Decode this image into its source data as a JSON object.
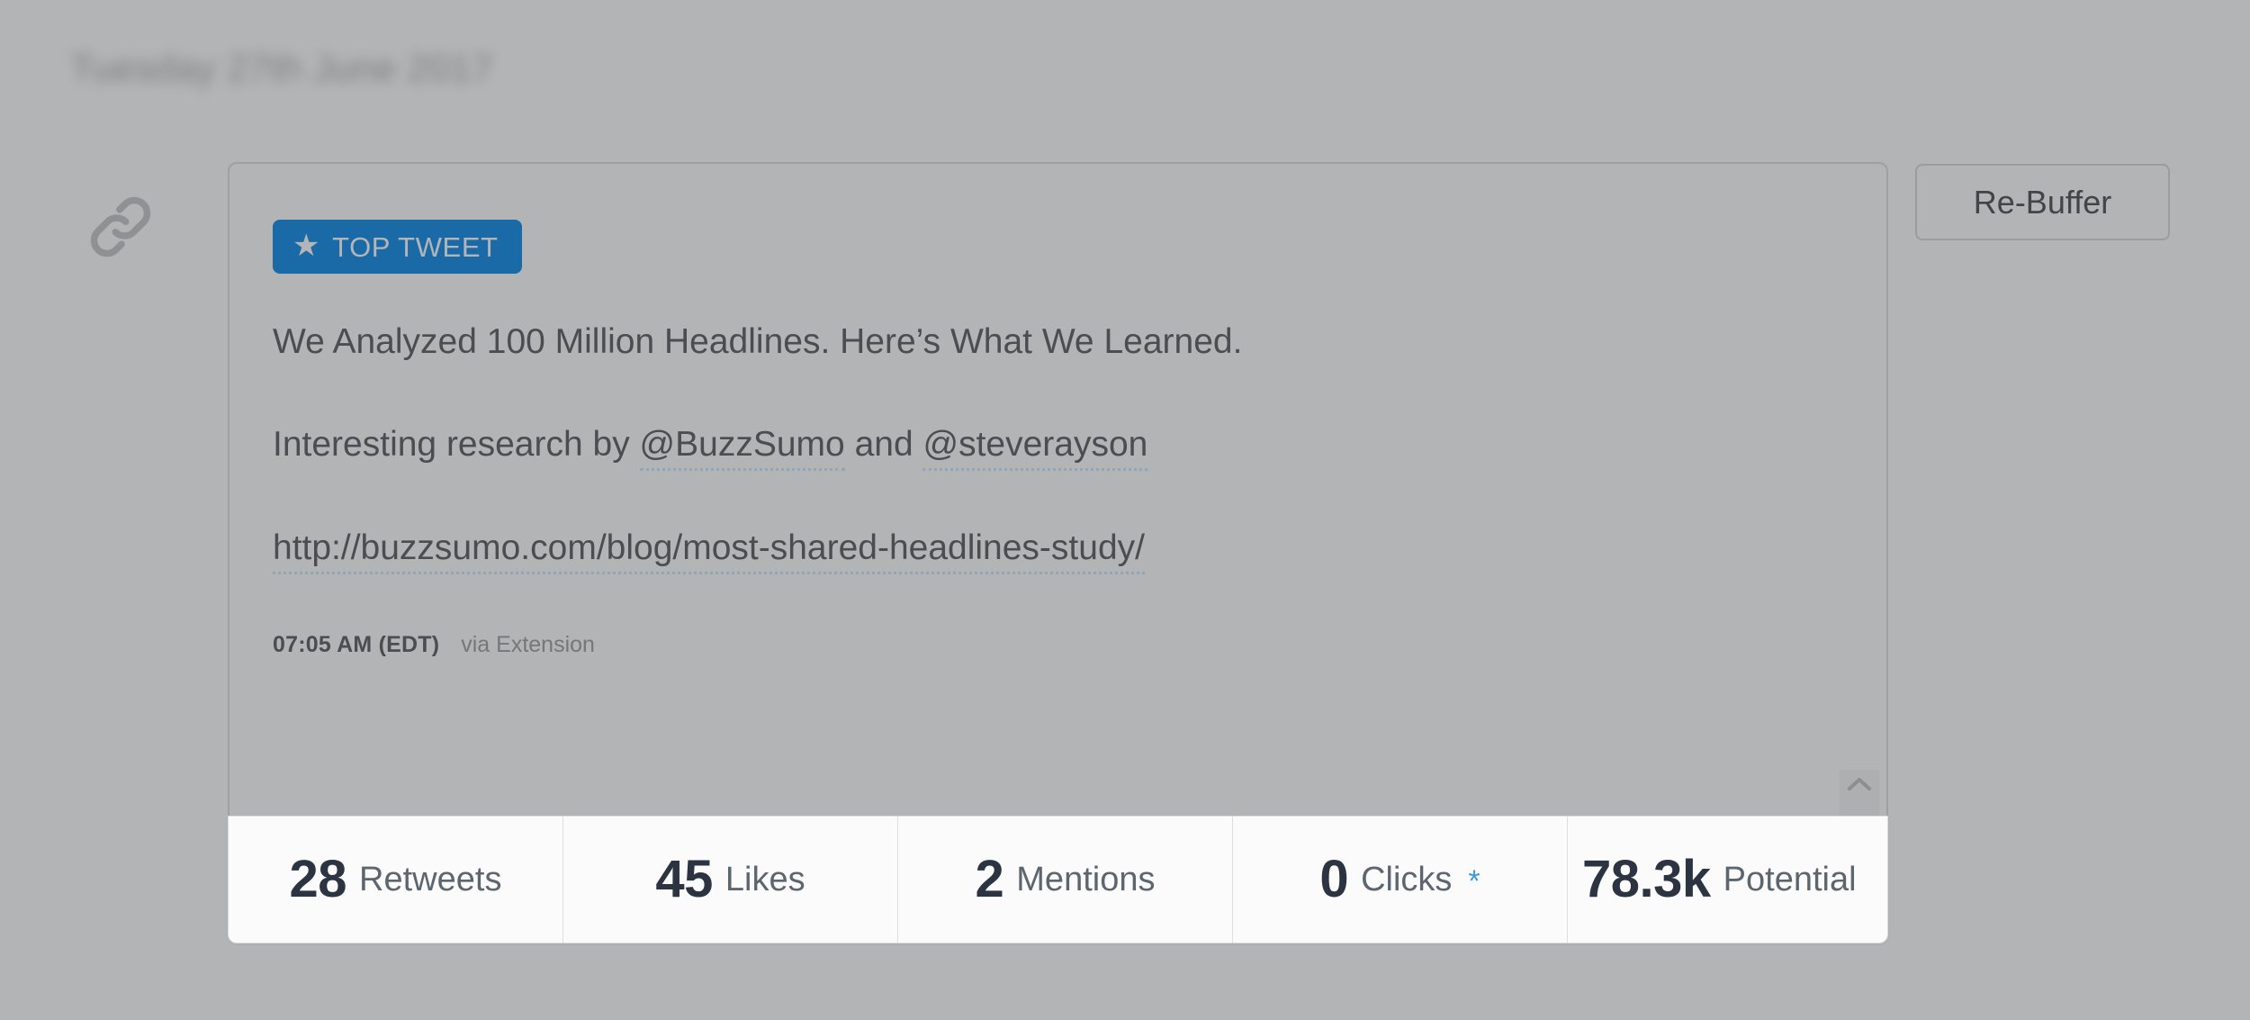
{
  "header": {
    "date_label": "Tuesday 27th June 2017"
  },
  "post": {
    "link_icon": "link-chain-icon",
    "badge": {
      "star_glyph": "★",
      "label": "TOP TWEET"
    },
    "text_lines": {
      "line1": "We Analyzed 100 Million Headlines. Here’s What We Learned.",
      "line2_prefix": "Interesting research by ",
      "mention1": "@BuzzSumo",
      "line2_middle": " and ",
      "mention2": "@steverayson",
      "line3_url": "http://buzzsumo.com/blog/most-shared-headlines-study/"
    },
    "meta": {
      "time": "07:05 AM (EDT)",
      "via": "via Extension"
    },
    "scroll_spinner": {
      "up_icon": "chevron-up-icon",
      "down_icon": "chevron-down-icon"
    },
    "stats": [
      {
        "value": "28",
        "label": "Retweets",
        "asterisk": ""
      },
      {
        "value": "45",
        "label": "Likes",
        "asterisk": ""
      },
      {
        "value": "2",
        "label": "Mentions",
        "asterisk": ""
      },
      {
        "value": "0",
        "label": "Clicks",
        "asterisk": "*"
      },
      {
        "value": "78.3k",
        "label": "Potential",
        "asterisk": ""
      }
    ]
  },
  "actions": {
    "rebuffer_label": "Re-Buffer"
  },
  "colors": {
    "page_background": "#b2b4b5",
    "badge_background": "#1b6aa8",
    "stats_background": "#fbfbfc",
    "asterisk_accent": "#3d9ae0",
    "text_primary": "#4a4d52",
    "card_border": "#9ea1a3"
  }
}
